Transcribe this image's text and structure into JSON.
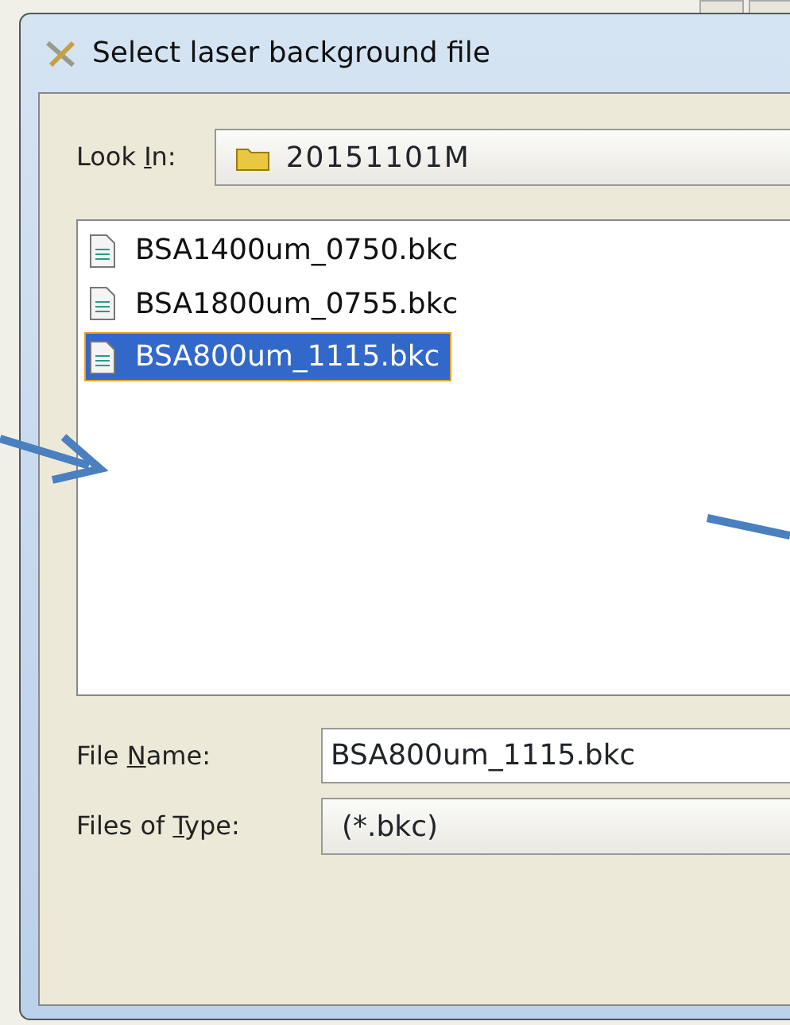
{
  "window": {
    "title": "Select laser background file"
  },
  "look_in": {
    "label": {
      "before": "Look ",
      "underlined": "I",
      "after": "n:"
    },
    "value": "20151101M"
  },
  "files": [
    {
      "name": "BSA1400um_0750.bkc",
      "selected": false
    },
    {
      "name": "BSA1800um_0755.bkc",
      "selected": false
    },
    {
      "name": "BSA800um_1115.bkc",
      "selected": true
    }
  ],
  "file_name": {
    "label": {
      "before": "File ",
      "underlined": "N",
      "after": "ame:"
    },
    "value": "BSA800um_1115.bkc"
  },
  "files_of_type": {
    "label": {
      "before": "Files of ",
      "underlined": "T",
      "after": "ype:"
    },
    "value": "(*.bkc)"
  }
}
